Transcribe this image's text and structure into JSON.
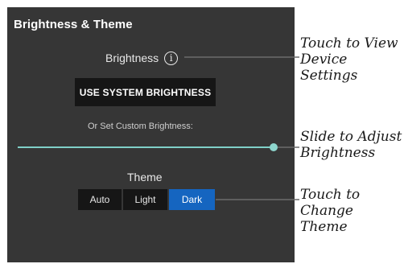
{
  "panel": {
    "title": "Brightness & Theme",
    "brightness_label": "Brightness",
    "info_glyph": "i",
    "system_button_label": "USE SYSTEM BRIGHTNESS",
    "custom_label": "Or Set Custom Brightness:",
    "slider_value": 1.0,
    "theme_label": "Theme",
    "theme_options": [
      "Auto",
      "Light",
      "Dark"
    ],
    "theme_selected": "Dark"
  },
  "callouts": {
    "info": [
      "Touch to View",
      "Device Settings"
    ],
    "slider": [
      "Slide to Adjust",
      "Brightness"
    ],
    "theme": [
      "Touch to",
      "Change Theme"
    ]
  },
  "colors": {
    "panel_bg": "#363636",
    "button_bg": "#161616",
    "selected": "#1565c0",
    "slider": "#7fd0c8"
  }
}
